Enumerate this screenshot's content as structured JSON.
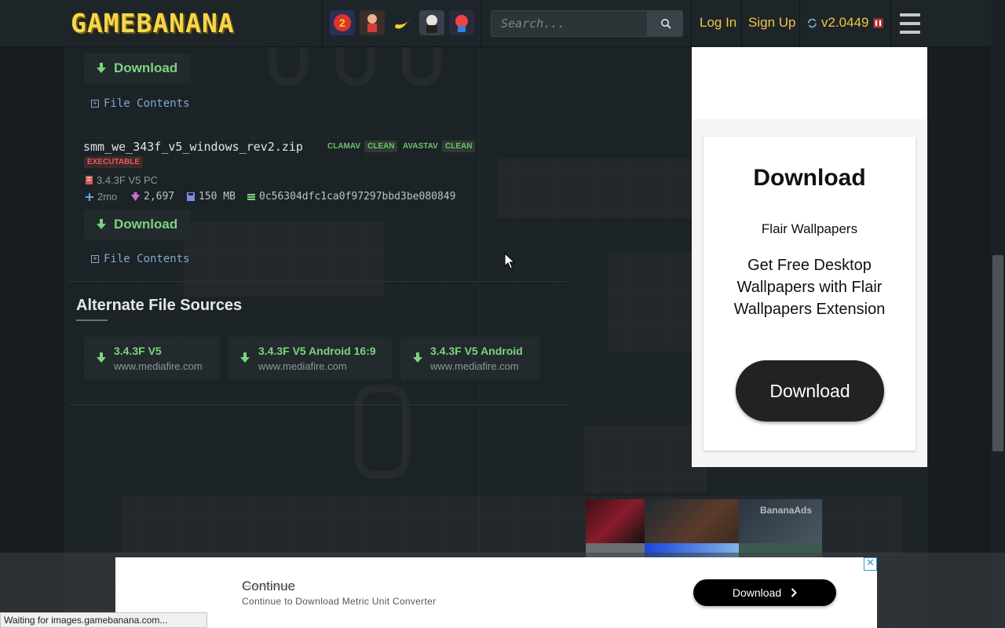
{
  "site": {
    "logo_text": "GAMEBANANA",
    "search_placeholder": "Search...",
    "login": "Log In",
    "signup": "Sign Up",
    "version": "v2.0449",
    "game_icons": [
      "game-icon-1",
      "game-icon-2",
      "game-icon-3",
      "game-icon-4",
      "game-icon-5"
    ]
  },
  "files": {
    "first_download_label": "Download",
    "first_file_contents": "File Contents",
    "second": {
      "name": "smm_we_343f_v5_windows_rev2.zip",
      "scan1_label": "CLAMAV",
      "scan1_status": "CLEAN",
      "scan2_label": "AVASTAV",
      "scan2_status": "CLEAN",
      "executable_badge": "EXECUTABLE",
      "description": "3.4.3F V5 PC",
      "age": "2mo",
      "downloads": "2,697",
      "size": "150 MB",
      "md5": "0c56304dfc1ca0f97297bbd3be080849",
      "download_label": "Download",
      "file_contents": "File Contents"
    }
  },
  "alternate": {
    "title": "Alternate File Sources",
    "sources": [
      {
        "title": "3.4.3F V5",
        "host": "www.mediafire.com"
      },
      {
        "title": "3.4.3F V5 Android 16:9",
        "host": "www.mediafire.com"
      },
      {
        "title": "3.4.3F V5 Android",
        "host": "www.mediafire.com"
      }
    ]
  },
  "side_ad": {
    "title": "Download",
    "brand": "Flair Wallpapers",
    "text": "Get Free Desktop Wallpapers with Flair Wallpapers Extension",
    "button": "Download"
  },
  "banana_ads": {
    "label": "BananaAds"
  },
  "bottom_ad": {
    "title": "Continue",
    "subtitle": "Continue to Download Metric Unit Converter",
    "button": "Download",
    "close": "✕"
  },
  "status_bar": "Waiting for images.gamebanana.com...",
  "colors": {
    "accent": "#f3c641",
    "green": "#7ed37e",
    "link": "#84a6cc",
    "danger": "#e25b5b"
  }
}
